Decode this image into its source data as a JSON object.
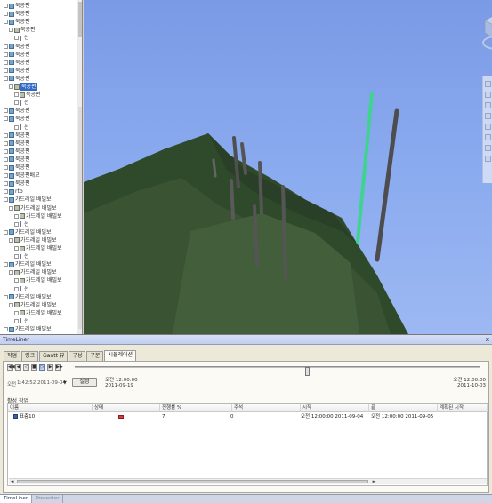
{
  "tree": {
    "items": [
      {
        "label": "북공편",
        "indent": 0,
        "icon": "group"
      },
      {
        "label": "북공편",
        "indent": 0,
        "icon": "group"
      },
      {
        "label": "북공편",
        "indent": 0,
        "icon": "group"
      },
      {
        "label": "북공편",
        "indent": 1,
        "icon": "model"
      },
      {
        "label": "선",
        "indent": 2,
        "icon": "line"
      },
      {
        "label": "북공편",
        "indent": 0,
        "icon": "group"
      },
      {
        "label": "북공편",
        "indent": 0,
        "icon": "group"
      },
      {
        "label": "북공편",
        "indent": 0,
        "icon": "group"
      },
      {
        "label": "북공편",
        "indent": 0,
        "icon": "group"
      },
      {
        "label": "북공편",
        "indent": 0,
        "icon": "group"
      },
      {
        "label": "북공편",
        "indent": 1,
        "icon": "model",
        "selected": true
      },
      {
        "label": "북공편",
        "indent": 2,
        "icon": "model"
      },
      {
        "label": "선",
        "indent": 2,
        "icon": "line"
      },
      {
        "label": "북공편",
        "indent": 0,
        "icon": "group"
      },
      {
        "label": "북공편",
        "indent": 0,
        "icon": "group"
      },
      {
        "label": "선",
        "indent": 2,
        "icon": "line"
      },
      {
        "label": "북공편",
        "indent": 0,
        "icon": "group"
      },
      {
        "label": "북공편",
        "indent": 0,
        "icon": "group"
      },
      {
        "label": "북공편",
        "indent": 0,
        "icon": "group"
      },
      {
        "label": "북공편",
        "indent": 0,
        "icon": "group"
      },
      {
        "label": "북공편",
        "indent": 0,
        "icon": "group"
      },
      {
        "label": "북공편배모",
        "indent": 0,
        "icon": "group"
      },
      {
        "label": "북공편",
        "indent": 0,
        "icon": "group"
      },
      {
        "label": "rtb",
        "indent": 0,
        "icon": "group"
      },
      {
        "label": "가드레일 배밀보",
        "indent": 0,
        "icon": "group"
      },
      {
        "label": "가드레일 배밀보",
        "indent": 1,
        "icon": "model"
      },
      {
        "label": "가드레일 배밀보",
        "indent": 2,
        "icon": "model"
      },
      {
        "label": "선",
        "indent": 2,
        "icon": "line"
      },
      {
        "label": "가드레일 배밀보",
        "indent": 0,
        "icon": "group"
      },
      {
        "label": "가드레일 배밀보",
        "indent": 1,
        "icon": "model"
      },
      {
        "label": "가드레일 배밀보",
        "indent": 2,
        "icon": "model"
      },
      {
        "label": "선",
        "indent": 2,
        "icon": "line"
      },
      {
        "label": "가드레일 배밀보",
        "indent": 0,
        "icon": "group"
      },
      {
        "label": "가드레일 배밀보",
        "indent": 1,
        "icon": "model"
      },
      {
        "label": "가드레일 배밀보",
        "indent": 2,
        "icon": "model"
      },
      {
        "label": "선",
        "indent": 2,
        "icon": "line"
      },
      {
        "label": "가드레일 배밀보",
        "indent": 0,
        "icon": "group"
      },
      {
        "label": "가드레일 배밀보",
        "indent": 1,
        "icon": "model"
      },
      {
        "label": "가드레일 배밀보",
        "indent": 2,
        "icon": "model"
      },
      {
        "label": "선",
        "indent": 2,
        "icon": "line"
      },
      {
        "label": "가드레일 배밀보",
        "indent": 0,
        "icon": "group"
      }
    ]
  },
  "panel": {
    "title": "TimeLiner",
    "close": "x",
    "tabs": [
      "작업",
      "링크",
      "Gantt 뷰",
      "구성",
      "구분",
      "시뮬레이션"
    ],
    "active_tab": 5,
    "date_label": "오전",
    "date_value": "1:42:52 2011-09-04",
    "date_arrow": "▼",
    "settings_button": "설정",
    "start_time_line1": "오전 12:00:00",
    "start_time_line2": "2011-09-19",
    "end_time_line1": "오전 12:00:00",
    "end_time_line2": "2011-10-03",
    "active_tasks_label": "활성 작업",
    "columns": [
      "이름",
      "상태",
      "진행률 %",
      "주석",
      "시작",
      "끝",
      "계획된 시작"
    ],
    "row": {
      "name": "표층10",
      "progress": "7",
      "notes": "0",
      "start": "오전 12:00:00 2011-09-04",
      "end": "오전 12:00:00 2011-09-05",
      "planned_start": ""
    },
    "scroll_left": "◄",
    "scroll_right": "►"
  },
  "transport": [
    "◀◀",
    "◀",
    "◁",
    "■",
    "▷",
    "▶",
    "▶▶"
  ],
  "dock": {
    "tabs": [
      "TimeLiner",
      "Presenter"
    ],
    "active_tab": 0
  },
  "colors": {
    "sky": "#8cacf0",
    "terrain": "#354d30",
    "highlight_pole": "#3fd38f",
    "pole": "#505050"
  }
}
